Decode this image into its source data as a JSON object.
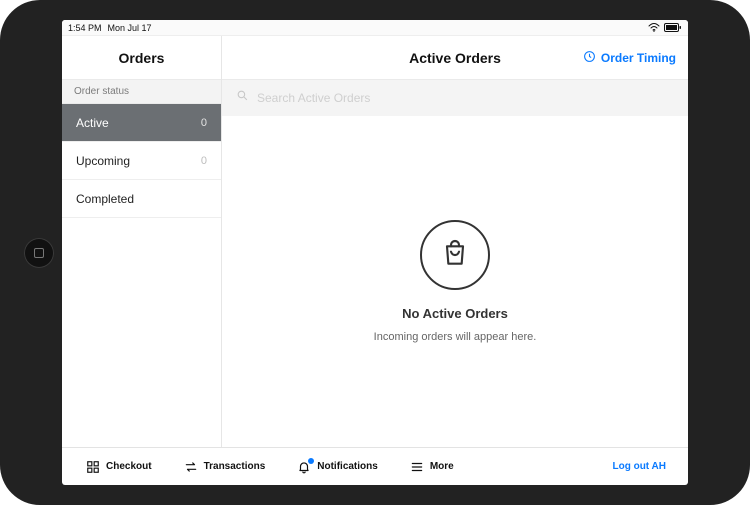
{
  "status": {
    "time": "1:54 PM",
    "date": "Mon Jul 17"
  },
  "sidebar": {
    "title": "Orders",
    "section_label": "Order status",
    "items": [
      {
        "label": "Active",
        "count": "0"
      },
      {
        "label": "Upcoming",
        "count": "0"
      },
      {
        "label": "Completed",
        "count": ""
      }
    ]
  },
  "main": {
    "title": "Active Orders",
    "order_timing_label": "Order Timing",
    "search_placeholder": "Search Active Orders",
    "empty_title": "No Active Orders",
    "empty_sub": "Incoming orders will appear here."
  },
  "tabs": {
    "checkout": "Checkout",
    "transactions": "Transactions",
    "notifications": "Notifications",
    "more": "More",
    "logout": "Log out AH"
  },
  "colors": {
    "accent": "#0a7aff"
  }
}
